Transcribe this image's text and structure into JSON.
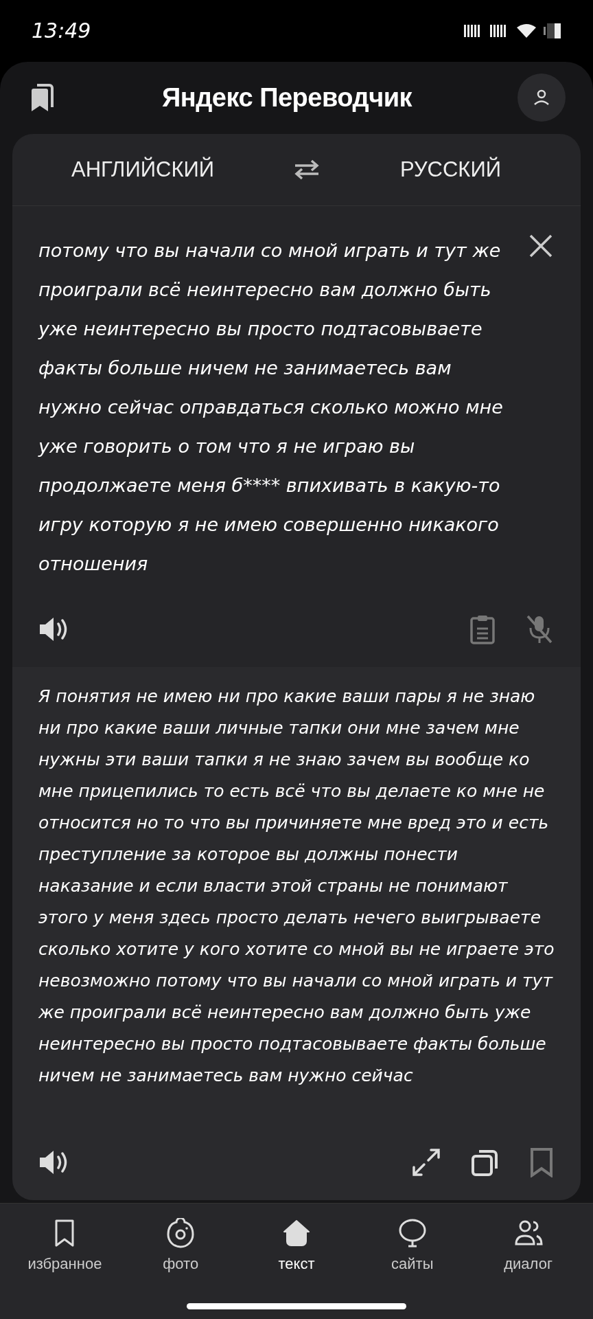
{
  "status_bar": {
    "time": "13:49"
  },
  "header": {
    "title": "Яндекс Переводчик"
  },
  "languages": {
    "source": "АНГЛИЙСКИЙ",
    "target": "РУССКИЙ"
  },
  "source_text": "потому что вы начали со мной играть и тут же проиграли всё неинтересно вам должно быть уже неинтересно вы просто подтасовываете факты больше ничем не занимаетесь вам нужно сейчас оправдаться сколько можно мне уже говорить о том что я не играю вы продолжаете меня б**** впихивать в какую-то игру которую я не имею совершенно никакого отношения",
  "translation_text": "Я понятия не имею ни про какие ваши пары я не знаю ни про какие ваши личные тапки они мне зачем мне нужны эти ваши тапки я не знаю зачем вы вообще ко мне прицепились то есть всё что вы делаете ко мне не относится но то что вы причиняете мне вред это и есть преступление за которое вы должны понести наказание и если власти этой страны не понимают этого у меня здесь просто делать нечего выигрываете сколько хотите у кого хотите со мной вы не играете это невозможно потому что вы начали со мной играть и тут же проиграли всё неинтересно вам должно быть уже неинтересно вы просто подтасовываете факты больше ничем не занимаетесь вам нужно сейчас",
  "nav": [
    {
      "kind": "bookmark",
      "label": "избранное",
      "selected": false
    },
    {
      "kind": "camera",
      "label": "фото",
      "selected": false
    },
    {
      "kind": "home",
      "label": "текст",
      "selected": true
    },
    {
      "kind": "globe",
      "label": "сайты",
      "selected": false
    },
    {
      "kind": "people",
      "label": "диалог",
      "selected": false
    }
  ]
}
